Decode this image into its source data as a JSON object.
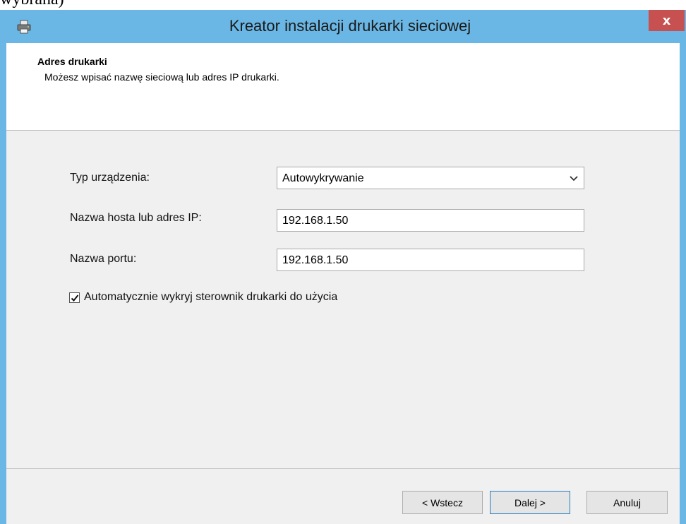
{
  "background": {
    "text": "wybrana)"
  },
  "window": {
    "title": "Kreator instalacji drukarki sieciowej",
    "close_label": "x"
  },
  "header": {
    "title": "Adres drukarki",
    "subtitle": "Możesz wpisać nazwę sieciową lub adres IP drukarki."
  },
  "form": {
    "device_type_label": "Typ urządzenia:",
    "device_type_value": "Autowykrywanie",
    "host_label": "Nazwa hosta lub adres IP:",
    "host_value": "192.168.1.50",
    "port_label": "Nazwa portu:",
    "port_value": "192.168.1.50",
    "auto_detect_label": "Automatycznie wykryj sterownik drukarki do użycia",
    "auto_detect_checked": true
  },
  "buttons": {
    "back": "< Wstecz",
    "next": "Dalej >",
    "cancel": "Anuluj"
  },
  "colors": {
    "titlebar": "#6ab6e4",
    "close": "#c75050",
    "client": "#f0f0f0"
  },
  "icons": {
    "app": "printer-icon",
    "dropdown": "chevron-down-icon",
    "check": "checkmark-icon"
  }
}
